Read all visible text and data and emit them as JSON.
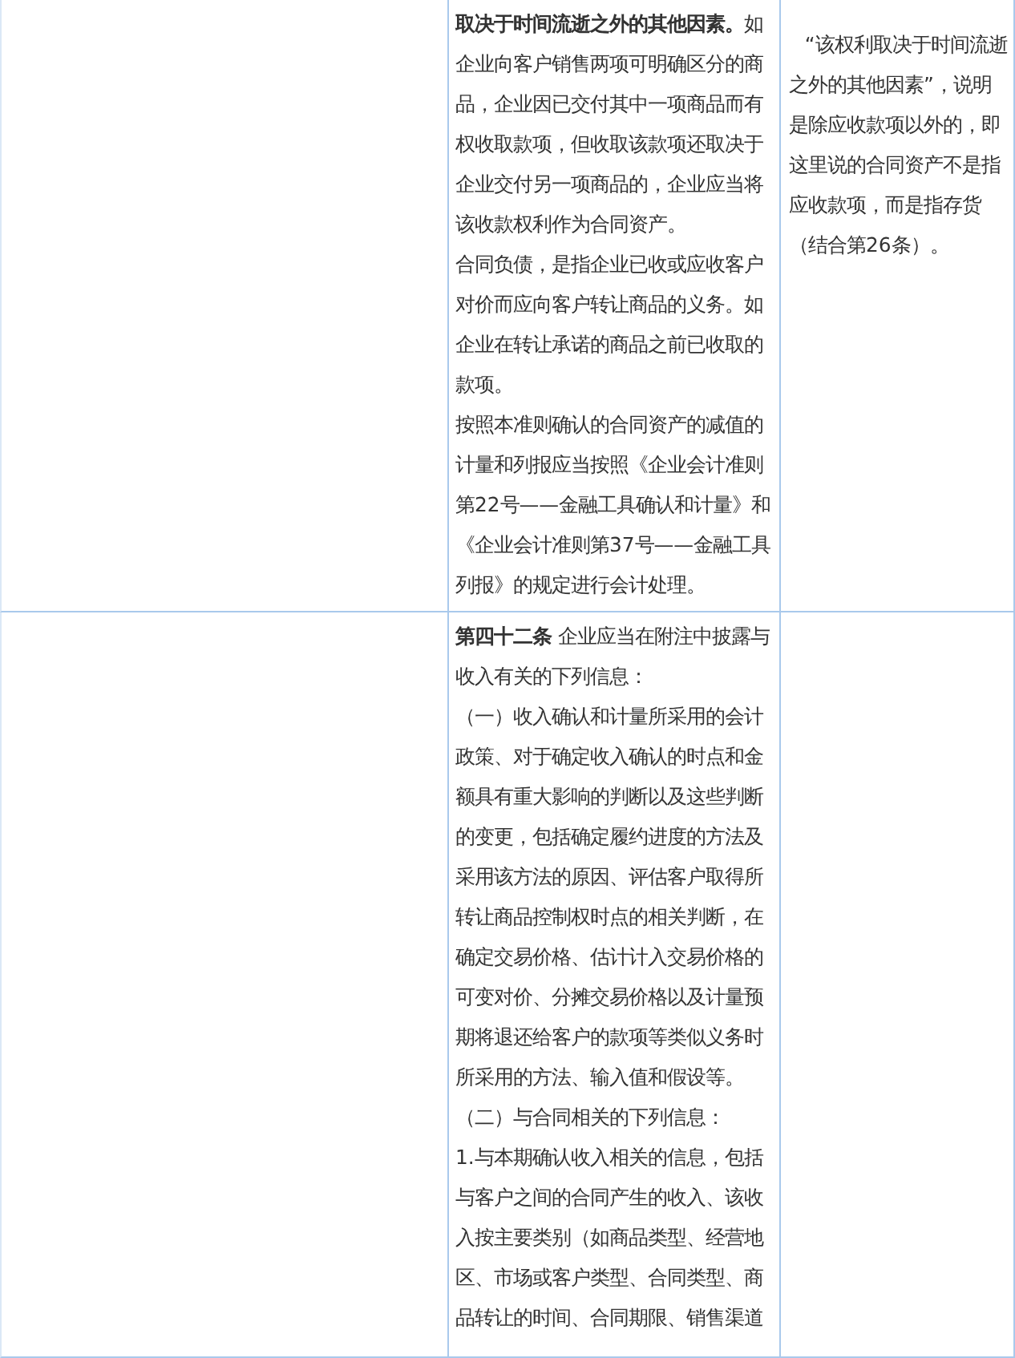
{
  "table": {
    "rows": [
      {
        "column_2": [
          "**取决于时间流逝之外的其他因素。**如企业向客户销售两项可明确区分的商品，企业因已交付其中一项商品而有权收取款项，但收取该款项还取决于企业交付另一项商品的，企业应当将该收款权利作为合同资产。",
          "合同负债，是指企业已收或应收客户对价而应向客户转让商品的义务。如企业在转让承诺的商品之前已收取的款项。",
          "按照本准则确认的合同资产的减值的计量和列报应当按照《企业会计准则第22号——金融工具确认和计量》和《企业会计准则第37号——金融工具列报》的规定进行会计处理。"
        ],
        "column_3": [
          "“该权利取决于时间流逝之外的其他因素”，说明是除应收款项以外的，即这里说的合同资产不是指应收款项，而是指存货（结合第26条）。"
        ]
      },
      {
        "column_2": [
          "**第四十二条** 企业应当在附注中披露与收入有关的下列信息：",
          "（一）收入确认和计量所采用的会计政策、对于确定收入确认的时点和金额具有重大影响的判断以及这些判断的变更，包括确定履约进度的方法及采用该方法的原因、评估客户取得所转让商品控制权时点的相关判断，在确定交易价格、估计计入交易价格的可变对价、分摊交易价格以及计量预期将退还给客户的款项等类似义务时所采用的方法、输入值和假设等。",
          "（二）与合同相关的下列信息：",
          "1.与本期确认收入相关的信息，包括与客户之间的合同产生的收入、该收入按主要类别（如商品类型、经营地区、市场或客户类型、合同类型、商品转让的时间、合同期限、销售渠道"
        ]
      }
    ]
  }
}
